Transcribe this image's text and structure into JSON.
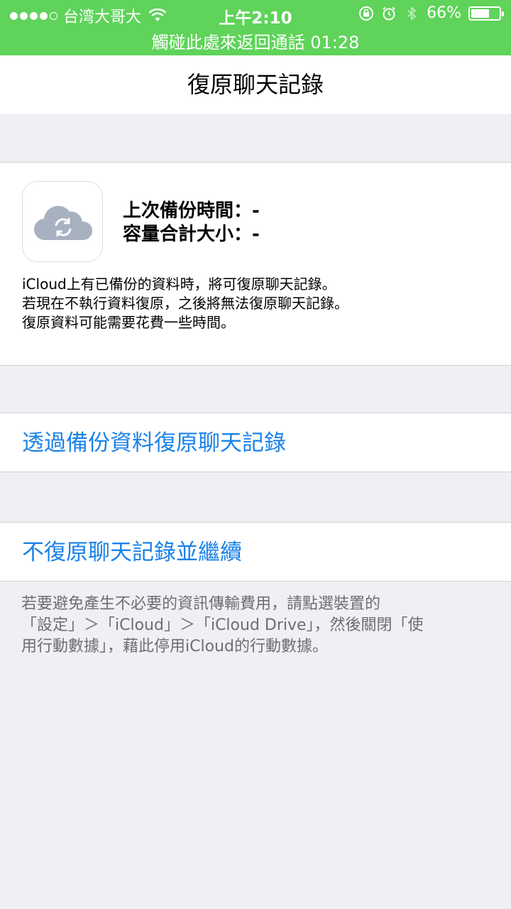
{
  "status_bar": {
    "carrier": "台湾大哥大",
    "time": "上午2:10",
    "battery": "66%",
    "battery_level": 0.66,
    "icons": [
      "wifi-icon",
      "rotation-lock-icon",
      "alarm-icon",
      "bluetooth-icon",
      "battery-icon"
    ],
    "call_banner": "觸碰此處來返回通話 01:28"
  },
  "nav": {
    "title": "復原聊天記錄"
  },
  "backup_info": {
    "icon": "icloud-sync-icon",
    "last_backup_time": "上次備份時間：-",
    "total_size": "容量合計大小：-",
    "description": [
      "iCloud上有已備份的資料時，將可復原聊天記錄。",
      "若現在不執行資料復原，之後將無法復原聊天記錄。",
      "復原資料可能需要花費一些時間。"
    ]
  },
  "actions": {
    "restore_label": "透過備份資料復原聊天記錄",
    "skip_label": "不復原聊天記錄並繼續"
  },
  "footnote": [
    "若要避免產生不必要的資訊傳輸費用，請點選裝置的",
    "「設定」＞「iCloud」＞「iCloud Drive」，然後關閉「使",
    "用行動數據」，藉此停用iCloud的行動數據。"
  ],
  "colors": {
    "status_bar_bg": "#5fd35a",
    "link_blue": "#1a82e8",
    "background": "#efeff4",
    "icon_gray": "#a8b1c0"
  }
}
